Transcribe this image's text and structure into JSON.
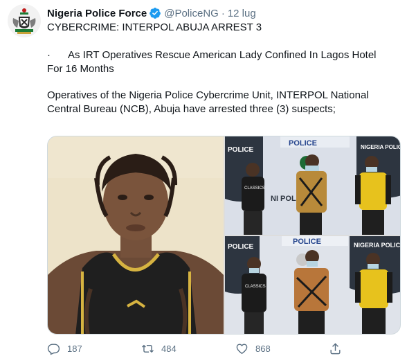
{
  "tweet": {
    "author_name": "Nigeria Police Force",
    "handle": "@PoliceNG",
    "separator": "·",
    "date": "12 lug",
    "line1": "CYBERCRIME: INTERPOL ABUJA ARREST 3",
    "bullet": "·",
    "line2": "As IRT Operatives Rescue American Lady Confined In Lagos Hotel For 16 Months",
    "line3": "Operatives of the Nigeria Police Cybercrime Unit, INTERPOL National Central Bureau (NCB), Abuja have arrested three (3) suspects;"
  },
  "media": {
    "photo1": {
      "jersey_text": ""
    },
    "photo2": {
      "banner_left": "POLICE",
      "banner_center": "POLICE",
      "banner_right": "NIGERIA POLICE",
      "shirt_text": "CLASSICS",
      "banner_bottom": "NI POL"
    },
    "photo3": {
      "banner_left": "POLICE",
      "banner_center": "POLICE",
      "banner_right": "NIGERIA POLICE",
      "shirt_text": "CLASSICS"
    }
  },
  "actions": {
    "replies": "187",
    "retweets": "484",
    "likes": "868"
  },
  "colors": {
    "text": "#0f1419",
    "secondary": "#5b7083",
    "verified": "#1d9bf0",
    "border": "#cfd9de"
  }
}
